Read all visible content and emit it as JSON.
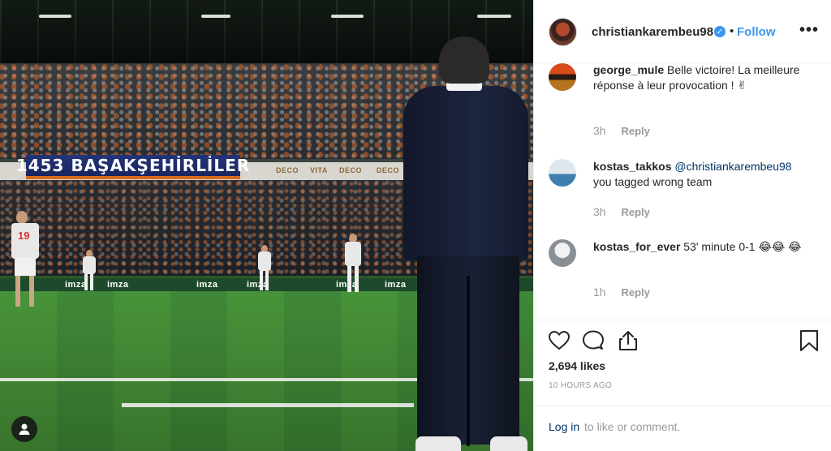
{
  "post": {
    "banner_text": "1453 BAŞAKŞEHİRLİLER",
    "sponsor_deco": "DECO",
    "sponsor_vita": "VITA",
    "ad_imza": "imza",
    "player_number": "19"
  },
  "header": {
    "username": "christiankarembeu98",
    "verified_glyph": "✓",
    "separator": "•",
    "follow_label": "Follow",
    "more_label": "•••"
  },
  "comments": [
    {
      "username": "george_mule",
      "text": "Belle victoire! La meilleure réponse à leur provocation ! ✌",
      "time": "3h",
      "reply_label": "Reply"
    },
    {
      "username": "kostas_takkos",
      "mention": "@christiankarembeu98",
      "text": "you tagged wrong team",
      "time": "3h",
      "reply_label": "Reply"
    },
    {
      "username": "kostas_for_ever",
      "text": "53' minute 0-1 😂😂 😂",
      "time": "1h",
      "reply_label": "Reply"
    }
  ],
  "actions": {
    "like_icon": "heart-icon",
    "comment_icon": "comment-icon",
    "share_icon": "share-icon",
    "save_icon": "bookmark-icon"
  },
  "stats": {
    "likes": "2,694 likes",
    "time_ago": "10 HOURS AGO"
  },
  "footer": {
    "login_label": "Log in",
    "login_rest": "to like or comment."
  },
  "colors": {
    "link_blue": "#3897f0",
    "mention_blue": "#003569",
    "muted": "#999999",
    "text": "#262626"
  }
}
